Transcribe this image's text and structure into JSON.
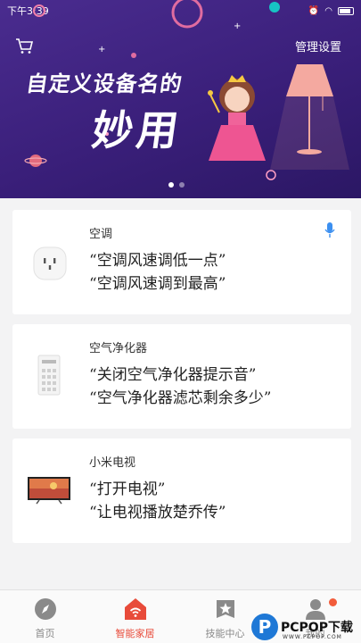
{
  "status_bar": {
    "time": "下午3:39"
  },
  "header": {
    "manage_label": "管理设置"
  },
  "banner": {
    "title_line1": "自定义设备名的",
    "title_line2": "妙用",
    "page_count": 2,
    "active_page": 1
  },
  "cards": [
    {
      "device_name": "空调",
      "commands": [
        "“空调风速调低一点”",
        "“空调风速调到最高”"
      ],
      "image": "socket-icon",
      "has_mic": true
    },
    {
      "device_name": "空气净化器",
      "commands": [
        "“关闭空气净化器提示音”",
        "“空气净化器滤芯剩余多少”"
      ],
      "image": "air-purifier-icon",
      "has_mic": false
    },
    {
      "device_name": "小米电视",
      "commands": [
        "“打开电视”",
        "“让电视播放楚乔传”"
      ],
      "image": "tv-icon",
      "has_mic": false
    }
  ],
  "tabs": [
    {
      "label": "首页",
      "icon": "compass-icon",
      "active": false
    },
    {
      "label": "智能家居",
      "icon": "smart-home-icon",
      "active": true
    },
    {
      "label": "技能中心",
      "icon": "star-icon",
      "active": false
    },
    {
      "label": "我的",
      "icon": "user-icon",
      "active": false
    }
  ],
  "watermark": {
    "logo": "P",
    "text": "PCPOP下载",
    "sub": "WWW.PCPOP.COM"
  },
  "colors": {
    "banner": "#3a1f7a",
    "accent": "#e84b3a",
    "mic": "#3b8ff0"
  }
}
